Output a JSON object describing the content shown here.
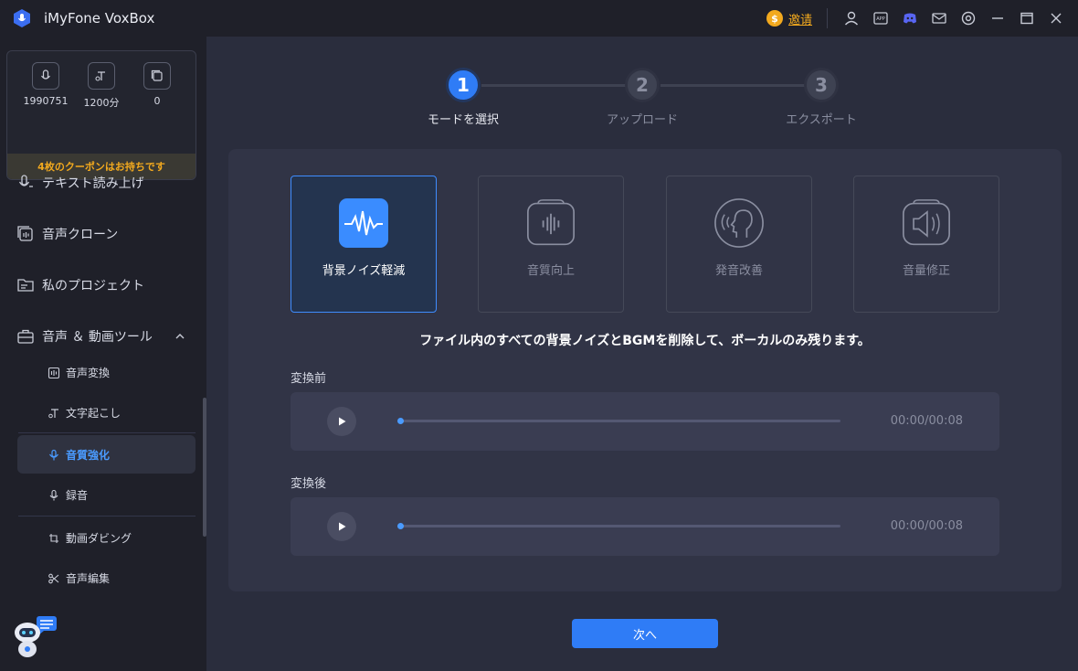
{
  "titlebar": {
    "app_title": "iMyFone VoxBox",
    "invite_label": "邀请",
    "icons": [
      "user-icon",
      "app-icon",
      "discord-icon",
      "mail-icon",
      "settings-icon",
      "minimize-icon",
      "maximize-icon",
      "close-icon"
    ]
  },
  "sidebar": {
    "stats": [
      {
        "value": "1990751",
        "icon": "mic-icon"
      },
      {
        "value": "1200分",
        "icon": "text-icon"
      },
      {
        "value": "0",
        "icon": "clone-icon"
      }
    ],
    "coupon": "4枚のクーポンはお持ちです",
    "nav": [
      {
        "label": "テキスト読み上げ",
        "icon": "tts-icon"
      },
      {
        "label": "音声クローン",
        "icon": "voice-clone-icon"
      },
      {
        "label": "私のプロジェクト",
        "icon": "folder-icon"
      },
      {
        "label": "音声 ＆ 動画ツール",
        "icon": "toolbox-icon"
      }
    ],
    "subnav": [
      {
        "label": "音声変換",
        "icon": "convert-icon"
      },
      {
        "label": "文字起こし",
        "icon": "transcribe-icon"
      },
      {
        "label": "音質強化",
        "icon": "enhance-icon"
      },
      {
        "label": "録音",
        "icon": "record-icon"
      },
      {
        "label": "動画ダビング",
        "icon": "dubbing-icon"
      },
      {
        "label": "音声編集",
        "icon": "edit-icon"
      }
    ]
  },
  "steps": [
    {
      "number": "1",
      "label": "モードを選択"
    },
    {
      "number": "2",
      "label": "アップロード"
    },
    {
      "number": "3",
      "label": "エクスポート"
    }
  ],
  "modes": [
    {
      "label": "背景ノイズ軽減",
      "icon": "waveform-icon"
    },
    {
      "label": "音質向上",
      "icon": "audio-bars-icon"
    },
    {
      "label": "発音改善",
      "icon": "speaking-head-icon"
    },
    {
      "label": "音量修正",
      "icon": "speaker-icon"
    }
  ],
  "description": "ファイル内のすべての背景ノイズとBGMを削除して、ボーカルのみ残ります。",
  "before": {
    "label": "変換前",
    "time": "00:00/00:08",
    "progress": 0
  },
  "after": {
    "label": "変換後",
    "time": "00:00/00:08",
    "progress": 0
  },
  "next_label": "次へ",
  "colors": {
    "accent": "#2f7cf6",
    "coin": "#f2a91e",
    "background": "#2a2d3d",
    "sidebar": "#1f2029"
  }
}
